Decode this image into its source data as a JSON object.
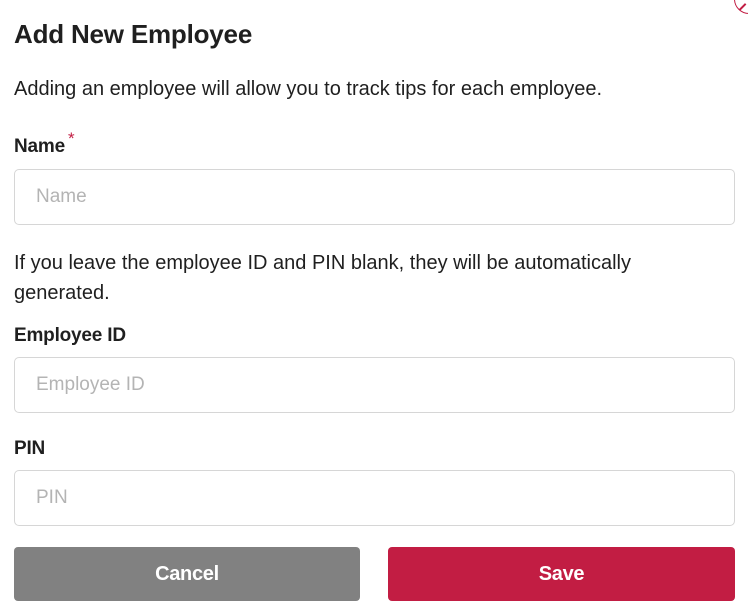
{
  "dialog": {
    "title": "Add New Employee",
    "intro": "Adding an employee will allow you to track tips for each employee.",
    "note": "If you leave the employee ID and PIN blank, they will be automatically generated."
  },
  "fields": {
    "name": {
      "label": "Name",
      "required_mark": "*",
      "placeholder": "Name",
      "value": ""
    },
    "employee_id": {
      "label": "Employee ID",
      "placeholder": "Employee ID",
      "value": ""
    },
    "pin": {
      "label": "PIN",
      "placeholder": "PIN",
      "value": ""
    }
  },
  "actions": {
    "cancel_label": "Cancel",
    "save_label": "Save"
  },
  "colors": {
    "accent": "#c21d43",
    "cancel": "#818181"
  },
  "icons": {
    "close": "close-icon"
  }
}
